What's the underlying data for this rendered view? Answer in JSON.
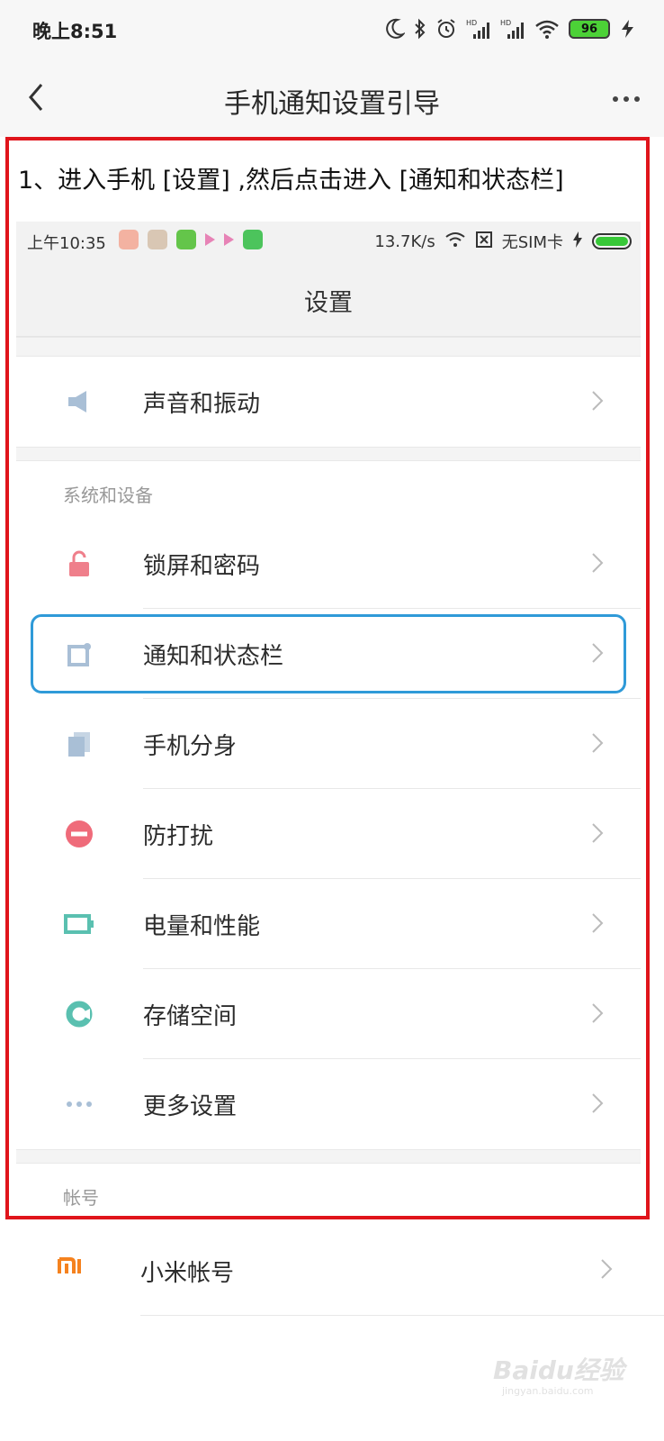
{
  "status_bar": {
    "time": "晚上8:51",
    "battery": "96",
    "icons": [
      "moon-icon",
      "bluetooth-icon",
      "alarm-icon",
      "hd-signal-icon",
      "hd-signal-icon",
      "wifi-icon",
      "battery-icon",
      "charging-icon"
    ]
  },
  "header": {
    "title": "手机通知设置引导",
    "back_icon": "chevron-left-icon",
    "more_icon": "more-dots-icon"
  },
  "guide": {
    "step_text": "1、进入手机 [设置] ,然后点击进入 [通知和状态栏]",
    "frame_color": "#e0141b",
    "phone": {
      "status_time": "上午10:35",
      "speed": "13.7K/s",
      "sim": "无SIM卡",
      "title": "设置",
      "rows_top": [
        {
          "label": "声音和振动",
          "icon": "speaker-icon",
          "color": "#a9bfd6"
        }
      ],
      "section_system": "系统和设备",
      "rows_system": [
        {
          "label": "锁屏和密码",
          "icon": "lock-icon",
          "color": "#ef7f8b"
        },
        {
          "label": "通知和状态栏",
          "icon": "notification-icon",
          "color": "#a9bfd6"
        },
        {
          "label": "手机分身",
          "icon": "clone-icon",
          "color": "#a9bfd6"
        },
        {
          "label": "防打扰",
          "icon": "do-not-disturb-icon",
          "color": "#ef6b7a"
        },
        {
          "label": "电量和性能",
          "icon": "battery-icon",
          "color": "#5ac0b0"
        },
        {
          "label": "存储空间",
          "icon": "storage-icon",
          "color": "#5ac0b0"
        },
        {
          "label": "更多设置",
          "icon": "more-dots-icon",
          "color": "#a9bfd6"
        }
      ],
      "section_account": "帐号",
      "highlight_color": "#2f9ad8"
    }
  },
  "outer_rows": [
    {
      "label": "小米帐号",
      "icon": "mi-logo-icon",
      "color": "#f5821f"
    }
  ],
  "watermark": {
    "brand": "Baidu经验",
    "url": "jingyan.baidu.com"
  }
}
